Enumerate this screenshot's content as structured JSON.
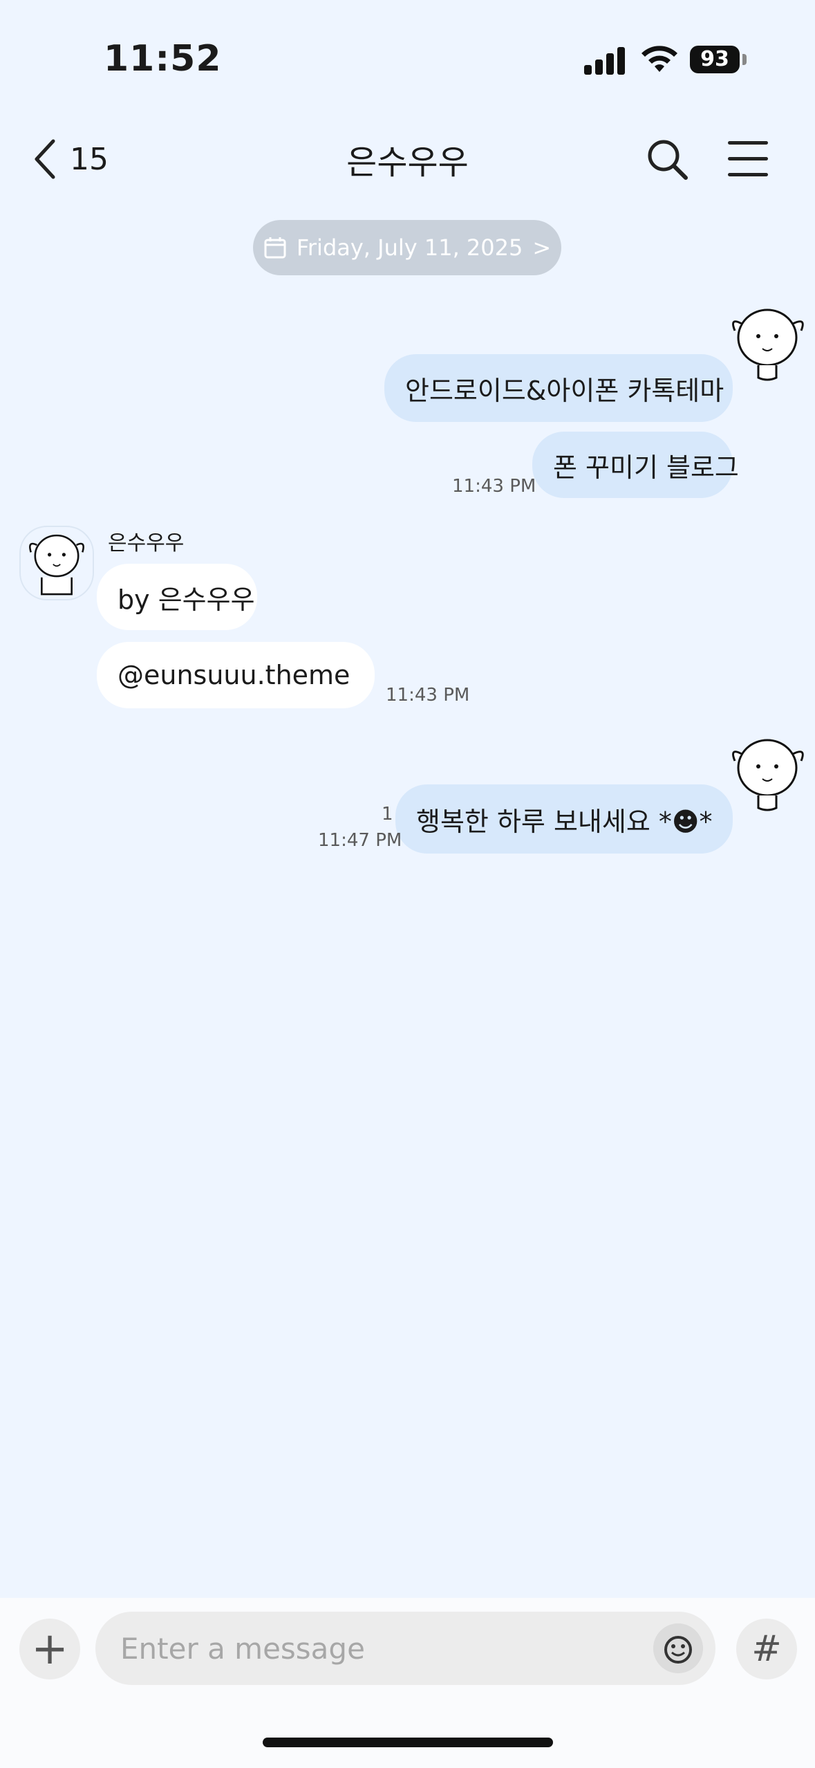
{
  "status_bar": {
    "time": "11:52",
    "battery": "93"
  },
  "header": {
    "back_count": "15",
    "title": "은수우우"
  },
  "date_pill": {
    "label": "Friday, July 11, 2025",
    "chevron": ">"
  },
  "messages": [
    {
      "from": "me",
      "text": "안드로이드&아이폰 카톡테마"
    },
    {
      "from": "me",
      "text": "폰 꾸미기 블로그",
      "time": "11:43 PM"
    },
    {
      "from": "other",
      "sender": "은수우우",
      "text": "by 은수우우"
    },
    {
      "from": "other",
      "text": "@eunsuuu.theme",
      "time": "11:43 PM"
    },
    {
      "from": "me",
      "text": "행복한 하루 보내세요 *☻*",
      "unread": "1",
      "time": "11:47 PM"
    }
  ],
  "input": {
    "placeholder": "Enter a message",
    "value": ""
  },
  "icons": {
    "back": "chevron-left-icon",
    "search": "search-icon",
    "menu": "hamburger-menu-icon",
    "calendar": "calendar-icon",
    "plus": "plus-icon",
    "emoji": "emoji-icon",
    "hash": "hash-icon"
  },
  "colors": {
    "background": "#eef5ff",
    "my_bubble": "#d7e8fb",
    "other_bubble": "#ffffff",
    "date_pill": "#c9d1db"
  }
}
